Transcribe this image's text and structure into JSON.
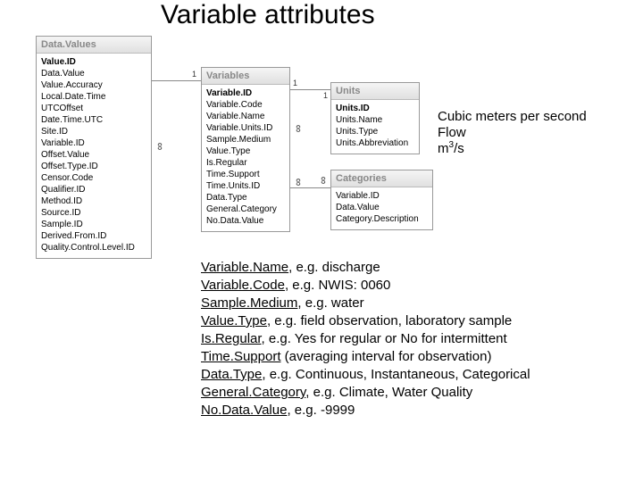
{
  "title": "Variable attributes",
  "tables": {
    "dataValues": {
      "header": "Data.Values",
      "fields": [
        "Value.ID",
        "Data.Value",
        "Value.Accuracy",
        "Local.Date.Time",
        "UTCOffset",
        "Date.Time.UTC",
        "Site.ID",
        "Variable.ID",
        "Offset.Value",
        "Offset.Type.ID",
        "Censor.Code",
        "Qualifier.ID",
        "Method.ID",
        "Source.ID",
        "Sample.ID",
        "Derived.From.ID",
        "Quality.Control.Level.ID"
      ]
    },
    "variables": {
      "header": "Variables",
      "fields": [
        "Variable.ID",
        "Variable.Code",
        "Variable.Name",
        "Variable.Units.ID",
        "Sample.Medium",
        "Value.Type",
        "Is.Regular",
        "Time.Support",
        "Time.Units.ID",
        "Data.Type",
        "General.Category",
        "No.Data.Value"
      ]
    },
    "units": {
      "header": "Units",
      "fields": [
        "Units.ID",
        "Units.Name",
        "Units.Type",
        "Units.Abbreviation"
      ]
    },
    "categories": {
      "header": "Categories",
      "fields": [
        "Variable.ID",
        "Data.Value",
        "Category.Description"
      ]
    }
  },
  "markers": {
    "one": "1",
    "inf": "∞"
  },
  "annotations": {
    "units_examples": [
      "Cubic meters per second",
      "Flow",
      "m",
      "3",
      "/s"
    ]
  },
  "descriptions": [
    {
      "term": "Variable.Name",
      "eg": ", e.g. discharge"
    },
    {
      "term": "Variable.Code",
      "eg": ", e.g. NWIS: 0060"
    },
    {
      "term": "Sample.Medium",
      "eg": ", e.g. water"
    },
    {
      "term": "Value.Type",
      "eg": ", e.g. field observation, laboratory sample"
    },
    {
      "term": "Is.Regular",
      "eg": ", e.g. Yes for regular or No for intermittent"
    },
    {
      "term": "Time.Support",
      "eg": " (averaging interval for observation)"
    },
    {
      "term": "Data.Type",
      "eg": ", e.g. Continuous, Instantaneous, Categorical"
    },
    {
      "term": "General.Category",
      "eg": ", e.g. Climate, Water Quality"
    },
    {
      "term": "No.Data.Value",
      "eg": ", e.g. -9999"
    }
  ]
}
